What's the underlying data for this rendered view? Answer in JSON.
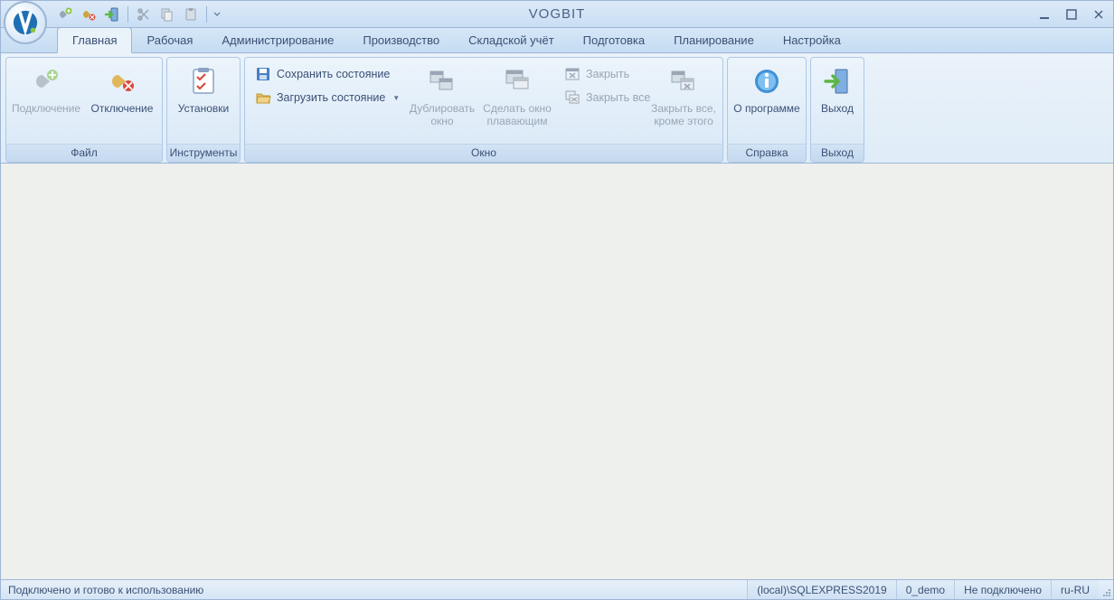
{
  "app": {
    "title": "VOGBIT"
  },
  "tabs": [
    {
      "label": "Главная"
    },
    {
      "label": "Рабочая"
    },
    {
      "label": "Администрирование"
    },
    {
      "label": "Производство"
    },
    {
      "label": "Складской учёт"
    },
    {
      "label": "Подготовка"
    },
    {
      "label": "Планирование"
    },
    {
      "label": "Настройка"
    }
  ],
  "ribbon": {
    "groups": {
      "file": {
        "title": "Файл",
        "connect": "Подключение",
        "disconnect": "Отключение"
      },
      "tools": {
        "title": "Инструменты",
        "settings": "Установки"
      },
      "window": {
        "title": "Окно",
        "save_state": "Сохранить состояние",
        "load_state": "Загрузить состояние",
        "duplicate": "Дублировать окно",
        "float": "Сделать окно плавающим",
        "close": "Закрыть",
        "close_all": "Закрыть все",
        "close_others": "Закрыть все, кроме этого"
      },
      "help": {
        "title": "Справка",
        "about": "О программе"
      },
      "exit": {
        "title": "Выход",
        "exit": "Выход"
      }
    }
  },
  "status": {
    "message": "Подключено и готово к использованию",
    "server": "(local)\\SQLEXPRESS2019",
    "database": "0_demo",
    "connection": "Не подключено",
    "locale": "ru-RU"
  }
}
